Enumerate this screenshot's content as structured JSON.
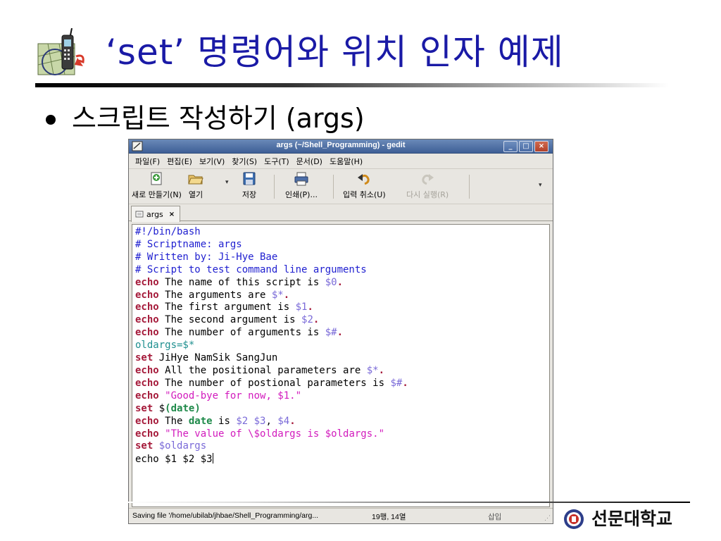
{
  "slide": {
    "title": "‘set’ 명령어와 위치 인자 예제",
    "bullet": "스크립트 작성하기 (args)"
  },
  "window": {
    "title": "args (~/Shell_Programming) - gedit",
    "buttons": [
      "_",
      "□",
      "×"
    ]
  },
  "menu": [
    "파일(F)",
    "편집(E)",
    "보기(V)",
    "찾기(S)",
    "도구(T)",
    "문서(D)",
    "도움말(H)"
  ],
  "toolbar": {
    "new_label": "새로 만들기(N)",
    "open_label": "열기",
    "save_label": "저장",
    "print_label": "인쇄(P)...",
    "undo_label": "입력 취소(U)",
    "redo_label": "다시 실행(R)"
  },
  "tab": {
    "label": "args",
    "close": "×"
  },
  "code_lines": [
    "#!/bin/bash",
    "# Scriptname: args",
    "# Written by: Ji-Hye Bae",
    "# Script to test command line arguments",
    "echo The name of this script is $0.",
    "echo The arguments are $*.",
    "echo The first argument is $1.",
    "echo The second argument is $2.",
    "echo The number of arguments is $#.",
    "oldargs=$*",
    "set JiHye NamSik SangJun",
    "echo All the positional parameters are $*.",
    "echo The number of postional parameters is $#.",
    "echo \"Good-bye for now, $1.\"",
    "set $(date)",
    "echo The date is $2 $3, $4.",
    "echo \"The value of \\$oldargs is $oldargs.\"",
    "set $oldargs",
    "echo $1 $2 $3"
  ],
  "status": {
    "file": "Saving file '/home/ubilab/jhbae/Shell_Programming/arg...",
    "position": "19행, 14열",
    "mode": "삽입"
  },
  "university": "선문대학교",
  "colors": {
    "title_blue": "#1a1aa6",
    "comment": "#1f1fd0",
    "keyword": "#a51a3a",
    "variable": "#7a6ad8",
    "string": "#d21bbd",
    "titlebar": "#4a6ca5"
  }
}
